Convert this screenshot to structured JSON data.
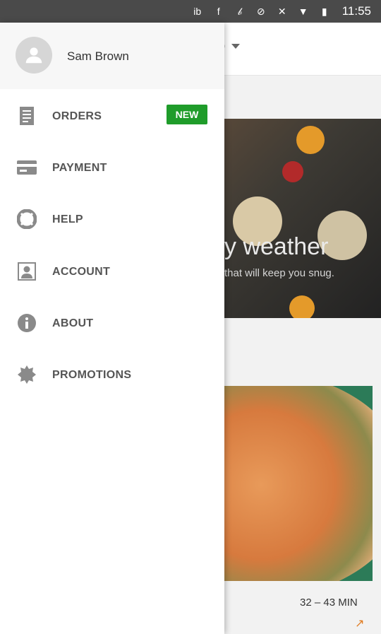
{
  "status_bar": {
    "icons": [
      "ib-icon",
      "facebook-icon",
      "b-icon",
      "blocked-icon",
      "signal-off-icon",
      "wifi-icon",
      "battery-icon"
    ],
    "time": "11:55"
  },
  "background": {
    "hero_title": "y weather",
    "hero_subtitle": "that will keep you snug.",
    "eta": "32 – 43 MIN"
  },
  "drawer": {
    "user_name": "Sam Brown",
    "new_badge": "NEW",
    "items": [
      {
        "label": "ORDERS",
        "icon": "orders-icon"
      },
      {
        "label": "PAYMENT",
        "icon": "payment-card-icon"
      },
      {
        "label": "HELP",
        "icon": "help-lifebuoy-icon"
      },
      {
        "label": "ACCOUNT",
        "icon": "account-icon"
      },
      {
        "label": "ABOUT",
        "icon": "info-icon"
      },
      {
        "label": "PROMOTIONS",
        "icon": "promotions-badge-icon"
      }
    ]
  },
  "colors": {
    "accent_green": "#1f9c2a",
    "icon_gray": "#8a8a8a",
    "status_bar": "#4a4a4a"
  }
}
